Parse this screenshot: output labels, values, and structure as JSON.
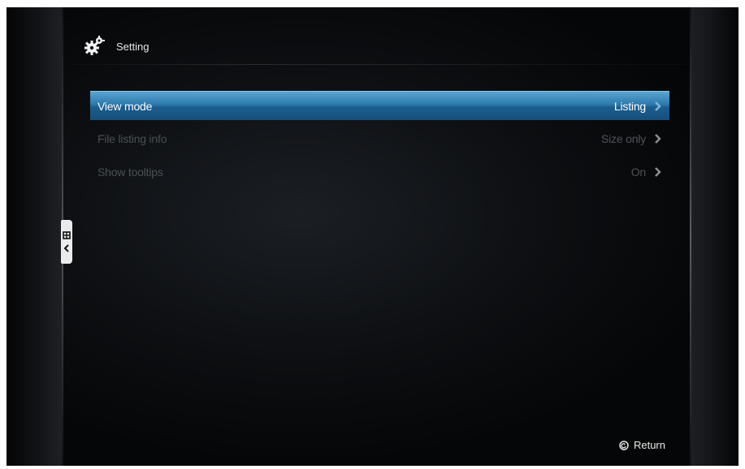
{
  "header": {
    "title": "Setting",
    "icon": "gear-icon"
  },
  "menu": {
    "items": [
      {
        "label": "View mode",
        "value": "Listing",
        "selected": true
      },
      {
        "label": "File listing info",
        "value": "Size only",
        "selected": false
      },
      {
        "label": "Show tooltips",
        "value": "On",
        "selected": false
      }
    ]
  },
  "footer": {
    "return_label": "Return",
    "return_icon": "return-icon"
  },
  "colors": {
    "highlight": "#2b79ad",
    "text_dim": "#4e5358",
    "text_bright": "#ffffff"
  }
}
